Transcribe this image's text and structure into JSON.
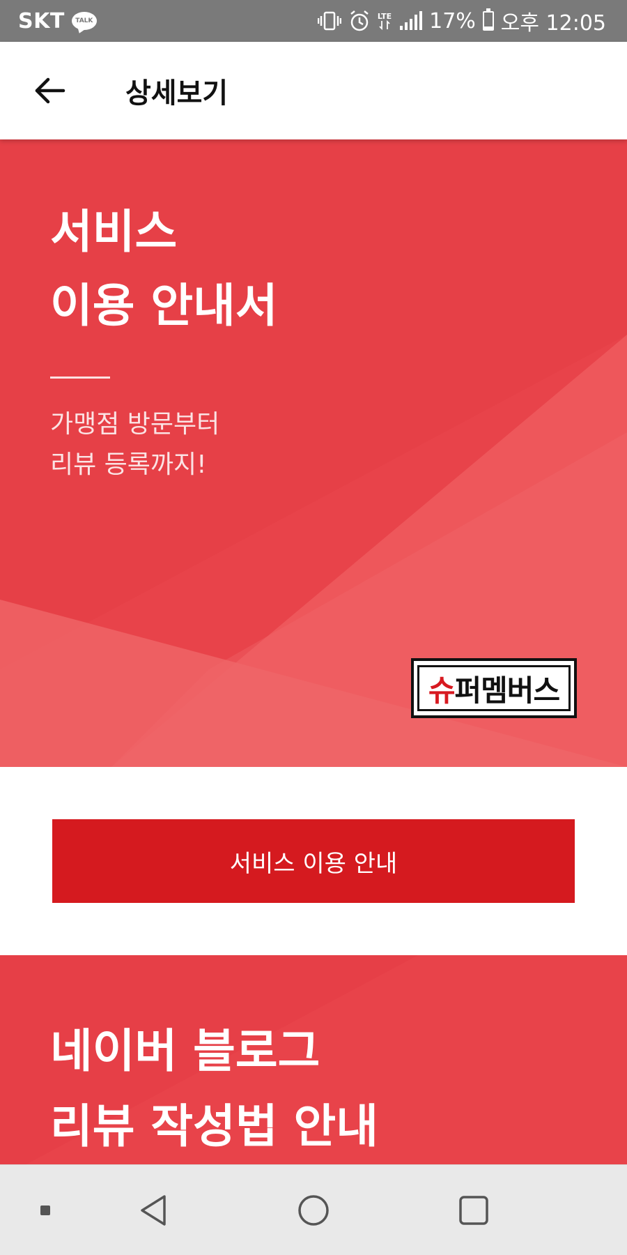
{
  "status_bar": {
    "carrier": "SKT",
    "talk_badge": "TALK",
    "lte_label": "LTE",
    "battery_percent": "17%",
    "battery_level": 0.17,
    "time": "오후 12:05",
    "icons": [
      "kakaotalk-icon",
      "vibrate-icon",
      "alarm-icon",
      "lte-icon",
      "signal-icon",
      "battery-icon"
    ]
  },
  "app_bar": {
    "title": "상세보기",
    "back_icon": "arrow-left-icon"
  },
  "hero": {
    "title_line1": "서비스",
    "title_line2": "이용 안내서",
    "subtitle_line1": "가맹점 방문부터",
    "subtitle_line2": "리뷰 등록까지!",
    "brand_logo_accent": "슈",
    "brand_logo_rest": "퍼멤버스",
    "background_color": "#e8434a"
  },
  "cta": {
    "label": "서비스 이용 안내",
    "color": "#d51a1f"
  },
  "section2": {
    "title_line1": "네이버 블로그",
    "title_line2": "리뷰 작성법 안내"
  },
  "nav_bar": {
    "items": [
      "menu-dot-icon",
      "back-triangle-icon",
      "home-circle-icon",
      "recents-square-icon"
    ]
  }
}
